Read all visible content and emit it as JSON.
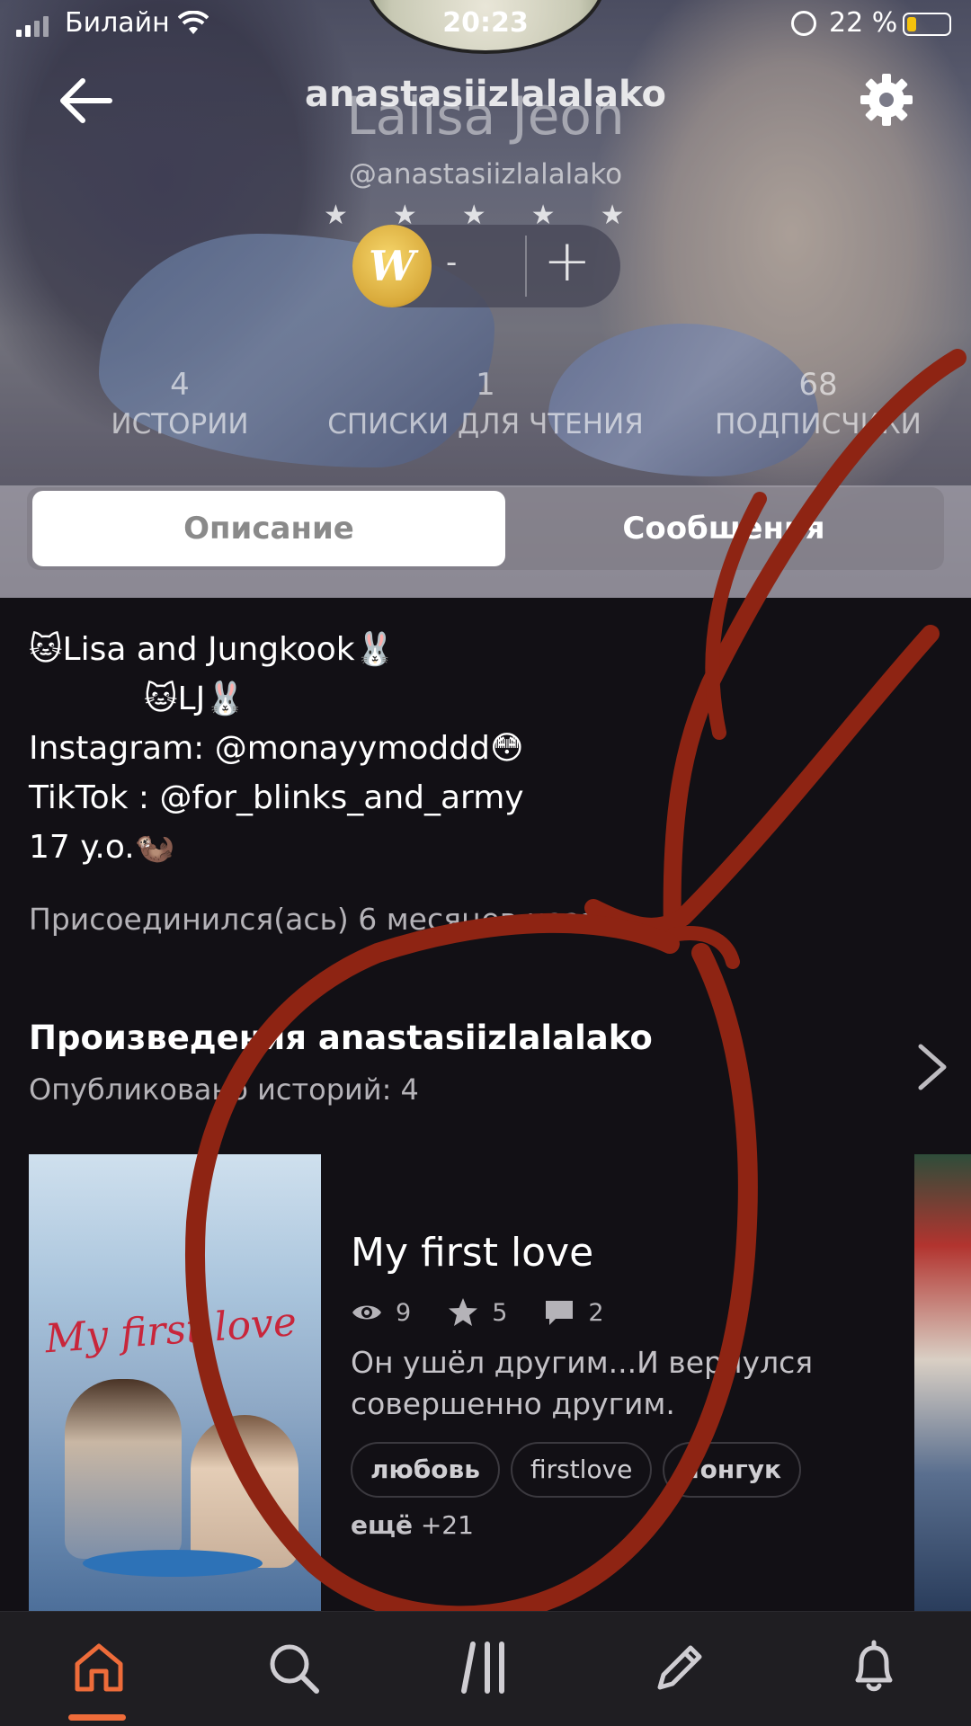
{
  "status_bar": {
    "carrier": "Билайн",
    "time": "20:23",
    "battery_percent": "22 %"
  },
  "profile": {
    "username": "anastasiizlalalako",
    "display_name": "Lalisa Jeon",
    "handle": "@anastasiizlalalako",
    "coins_value": "-",
    "coin_letter": "W",
    "stats": [
      {
        "count": "4",
        "label": "ИСТОРИИ"
      },
      {
        "count": "1",
        "label": "СПИСКИ ДЛЯ ЧТЕНИЯ"
      },
      {
        "count": "68",
        "label": "ПОДПИСЧИКИ"
      }
    ]
  },
  "tabs": {
    "about": "Описание",
    "messages": "Сообщения"
  },
  "about": {
    "lines": [
      "🐱Lisa and Jungkook🐰",
      "🐱LJ🐰",
      "Instagram: @monayymoddd😳",
      "TikTok : @for_blinks_and_army",
      "17 y.o.🦦"
    ],
    "joined": "Присоединился(ась) 6 месяцев назад"
  },
  "works": {
    "title": "Произведения anastasiizlalalako",
    "subtitle": "Опубликовано историй: 4",
    "story": {
      "cover_title": "My first love",
      "title": "My first love",
      "views": "9",
      "votes": "5",
      "comments": "2",
      "description": "Он ушёл другим...И вернулся совершенно другим.",
      "tags": [
        "любовь",
        "firstlove",
        "чонгук"
      ],
      "more_label": "ещё",
      "more_count": "+21"
    }
  },
  "colors": {
    "accent": "#ee6c3a",
    "annotation": "#8e2413",
    "background": "#121015"
  },
  "nav": {
    "items": [
      "home-icon",
      "search-icon",
      "library-icon",
      "write-icon",
      "notifications-icon"
    ]
  }
}
